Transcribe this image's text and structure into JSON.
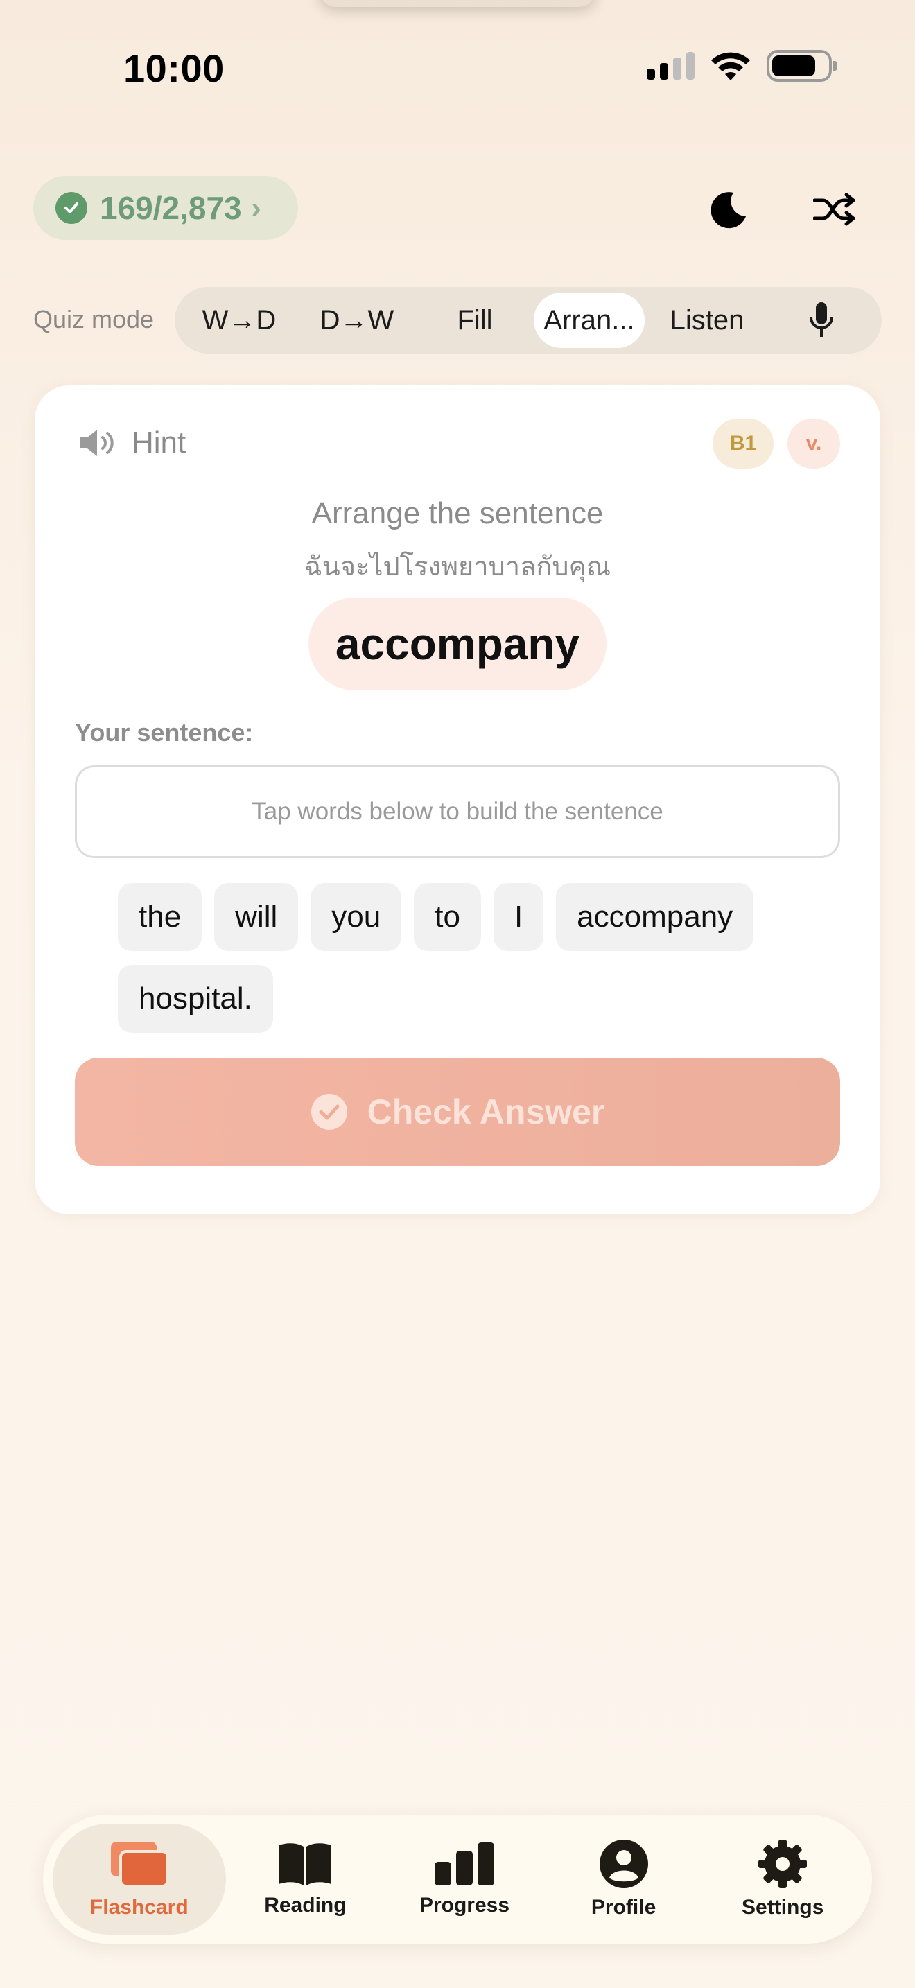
{
  "status_bar": {
    "time": "10:00"
  },
  "header": {
    "progress_text": "169/2,873",
    "chevron": "›",
    "icons": [
      "moon-icon",
      "shuffle-icon"
    ]
  },
  "quiz": {
    "label": "Quiz mode",
    "modes": [
      {
        "label": "W→D",
        "active": false
      },
      {
        "label": "D→W",
        "active": false
      },
      {
        "label": "Fill",
        "active": false
      },
      {
        "label": "Arran...",
        "active": true
      },
      {
        "label": "Listen",
        "active": false
      }
    ]
  },
  "card": {
    "hint_label": "Hint",
    "level_badge": "B1",
    "pos_badge": "v.",
    "instruction": "Arrange the sentence",
    "thai_translation": "ฉันจะไปโรงพยาบาลกับคุณ",
    "target_word": "accompany",
    "sentence_label": "Your sentence:",
    "sentence_placeholder": "Tap words below to build the sentence",
    "word_chips": [
      "the",
      "will",
      "you",
      "to",
      "I",
      "accompany",
      "hospital."
    ],
    "check_button": "Check Answer"
  },
  "tabbar": {
    "tabs": [
      {
        "label": "Flashcard",
        "icon": "flashcard-icon",
        "active": true
      },
      {
        "label": "Reading",
        "icon": "book-icon",
        "active": false
      },
      {
        "label": "Progress",
        "icon": "bar-chart-icon",
        "active": false
      },
      {
        "label": "Profile",
        "icon": "person-icon",
        "active": false
      },
      {
        "label": "Settings",
        "icon": "gear-icon",
        "active": false
      }
    ]
  },
  "colors": {
    "accent": "#e06a3e",
    "success": "#5f9a6b",
    "button_disabled": "#f4b6a4"
  }
}
